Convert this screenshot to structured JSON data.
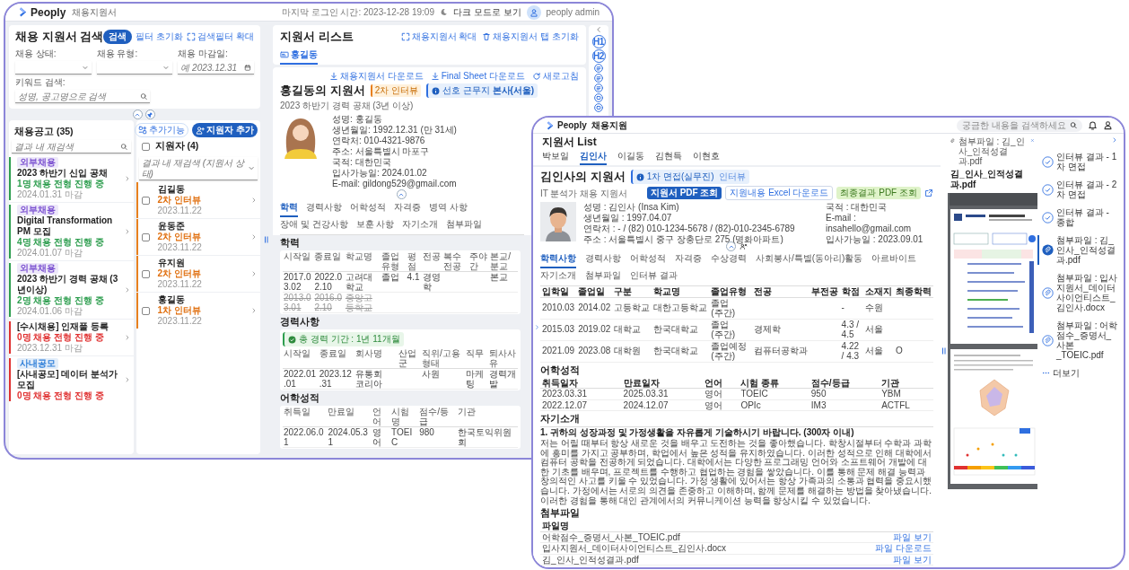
{
  "back_window": {
    "top_bar": {
      "app_name": "Peoply",
      "section": "채용지원서",
      "last_login": "마지막 로그인 시간: 2023-12-28 19:09",
      "dark_mode": "다크 모드로 보기",
      "user": "peoply admin"
    },
    "search": {
      "title": "채용 지원서 검색",
      "search_button": "검색",
      "reset_button": "필터 초기화",
      "expand_button": "검색필터 확대",
      "filters": [
        {
          "label": "채용 상태:",
          "kind": "select"
        },
        {
          "label": "채용 유형:",
          "kind": "select"
        },
        {
          "label": "채용 마감일:",
          "kind": "date",
          "placeholder": "예 2023.12.31"
        }
      ],
      "keyword": {
        "label": "키워드 검색:",
        "placeholder": "성명, 공고명으로 검색"
      }
    },
    "postings": {
      "title": "채용공고 (35)",
      "search_placeholder": "결과 내 재검색",
      "items": [
        {
          "tag": {
            "text": "외부채용",
            "color": "#7a4fd0"
          },
          "title": "2023 하반기 신입 공채",
          "status": "1명 채용 전형 진행 중",
          "deadline": "2024.01.31 마감",
          "color": "#2e9e4f"
        },
        {
          "tag": {
            "text": "외부채용",
            "color": "#7a4fd0"
          },
          "title": "Digital Transformation PM 모집",
          "status": "4명 채용 전형 진행 중",
          "deadline": "2024.01.07 마감",
          "color": "#2e9e4f"
        },
        {
          "tag": {
            "text": "외부채용",
            "color": "#7a4fd0"
          },
          "title": "2023 하반기 경력 공채 (3년이상)",
          "status": "2명 채용 전형 진행 중",
          "deadline": "2024.01.06 마감",
          "color": "#2e9e4f"
        },
        {
          "title": "[수시채용] 인재풀 등록",
          "status": "0명 채용 전형 진행 중",
          "deadline": "2023.12.31 마감",
          "color": "#e03131"
        },
        {
          "tag": {
            "text": "사내공모",
            "color": "#2f7fd8"
          },
          "title": "[사내공모] 데이터 분석가 모집",
          "status": "0명 채용 전형 진행 중",
          "color": "#e03131"
        }
      ]
    },
    "applicants": {
      "title": "지원자 (4)",
      "all_checked": false,
      "more_button": "추가기능",
      "add_button": "지원자 추가",
      "filter_placeholder": "결과 내 재검색 (지원서 상태)",
      "items": [
        {
          "name": "김길동",
          "stage": "2차 인터뷰",
          "date": "2023.11.22",
          "checked": false
        },
        {
          "name": "윤동준",
          "stage": "2차 인터뷰",
          "date": "2023.11.22",
          "checked": false
        },
        {
          "name": "유지원",
          "stage": "2차 인터뷰",
          "date": "2023.11.22",
          "checked": false
        },
        {
          "name": "홍길동",
          "stage": "1차 인터뷰",
          "date": "2023.11.22",
          "checked": false
        }
      ]
    },
    "viewer": {
      "title": "지원서 리스트",
      "expand_button": "채용지원서 확대",
      "reset_button": "채용지원서 탭 초기화",
      "tabs": [
        {
          "label": "홍길동",
          "selected": true
        }
      ],
      "actions": [
        {
          "kind": "download",
          "label": "채용지원서 다운로드"
        },
        {
          "kind": "download",
          "label": "Final Sheet 다운로드"
        },
        {
          "kind": "refresh",
          "label": "새로고침"
        }
      ],
      "heading": "홍길동의 지원서",
      "stage": "2차 인터뷰",
      "preference": "선호 근무지 **본사(서울)**",
      "subtitle": "2023 하반기 경력 공채 (3년 이상)",
      "info_left": [
        "성명: 홍길동",
        "생년월일: 1992.12.31 (만 31세)",
        "연락처: 010-4321-9876",
        "주소: 서울특별시 마포구"
      ],
      "info_right": [
        "국적: 대한민국",
        "입사가능일: 2024.01.02",
        "E-mail: gildong529@gmail.com"
      ],
      "section_tabs": [
        {
          "label": "학력",
          "selected": true
        },
        {
          "label": "경력사항",
          "selected": false
        },
        {
          "label": "어학성적",
          "selected": false
        },
        {
          "label": "자격증",
          "selected": false
        },
        {
          "label": "병역 사항",
          "selected": false
        },
        {
          "label": "장애 및 건강사항",
          "selected": false
        },
        {
          "label": "보훈 사항",
          "selected": false
        },
        {
          "label": "자기소개",
          "selected": false
        },
        {
          "label": "첨부파일",
          "selected": false
        }
      ],
      "sections": [
        {
          "title": "학력",
          "columns": [
            "시작일",
            "종료일",
            "학교명",
            "졸업유형",
            "평점",
            "전공",
            "복수전공",
            "주야간",
            "본교/분교"
          ],
          "rows": [
            {
              "cells": [
                "2017.03.02",
                "2022.02.10",
                "고려대학교",
                "졸업",
                "4.1",
                "경영학",
                null,
                null,
                "본교"
              ],
              "struck": false
            },
            {
              "cells": [
                "2013.03.01",
                "2016.02.10",
                "중앙고등학교",
                null,
                null,
                null,
                null,
                null,
                null
              ],
              "struck": true
            }
          ]
        },
        {
          "title": "경력사항",
          "summary": "총 경력 기간 : 1년 11개월",
          "columns": [
            "시작일",
            "종료일",
            "회사명",
            "산업군",
            "직위/고용형태",
            "직무",
            "퇴사사유"
          ],
          "rows": [
            {
              "cells": [
                "2022.01.01",
                "2023.12.31",
                "유통회 코리아",
                null,
                "사원",
                "마케팅",
                "경력개발"
              ],
              "struck": false
            }
          ]
        },
        {
          "title": "어학성적",
          "columns": [
            "취득일",
            "만료일",
            "언어",
            "시험명",
            "점수/등급",
            "기관"
          ],
          "rows": [
            {
              "cells": [
                "2022.06.01",
                "2024.05.31",
                "영어",
                "TOEIC",
                "980",
                "한국토익위원회"
              ],
              "struck": false
            }
          ]
        }
      ]
    },
    "rail": [
      {
        "kind": "collapse"
      },
      {
        "kind": "heading",
        "label": "H1"
      },
      {
        "kind": "heading",
        "label": "H2"
      },
      {
        "kind": "list"
      },
      {
        "kind": "list"
      },
      {
        "kind": "list"
      },
      {
        "kind": "card"
      },
      {
        "kind": "card"
      }
    ]
  },
  "front_window": {
    "top_bar": {
      "app_name": "Peoply",
      "section": "채용지원",
      "search_placeholder": "궁금한 내용을 검색하세요"
    },
    "title": "지원서 List",
    "tabs": [
      {
        "label": "박보일",
        "selected": false
      },
      {
        "label": "김인사",
        "selected": true
      },
      {
        "label": "이길동",
        "selected": false
      },
      {
        "label": "김현득",
        "selected": false
      },
      {
        "label": "이현호",
        "selected": false
      }
    ],
    "heading": "김인사의 지원서",
    "stage": "1차 면접(실무진)",
    "stage_type": "인터뷰",
    "subtitle": "IT 분석가 채용 지원서",
    "buttons": [
      {
        "label": "지원서 PDF 조회",
        "kind": "primary"
      },
      {
        "label": "지원내용 Excel 다운로드",
        "kind": "outline"
      },
      {
        "label": "최종결과 PDF 조회",
        "kind": "success"
      }
    ],
    "info_left": [
      "성명 : 김인사 (Insa Kim)",
      "생년월일 : 1997.04.07",
      "연락처 : - / (82) 010-1234-5678 / (82)-010-2345-6789",
      "주소 : 서울특별시 중구 장충단로 275 (명화아파트)"
    ],
    "info_right": [
      "국적 : 대한민국",
      "E-mail : insahello@gmail.com",
      "입사가능일 : 2023.09.01"
    ],
    "section_tabs": [
      {
        "label": "학력사항",
        "selected": true
      },
      {
        "label": "경력사항",
        "selected": false
      },
      {
        "label": "어학성적",
        "selected": false
      },
      {
        "label": "자격증",
        "selected": false
      },
      {
        "label": "수상경력",
        "selected": false
      },
      {
        "label": "사회봉사/특별(동아리)활동",
        "selected": false
      },
      {
        "label": "아르바이트",
        "selected": false
      },
      {
        "label": "자기소개",
        "selected": false
      },
      {
        "label": "첨부파일",
        "selected": false
      },
      {
        "label": "인터뷰 결과",
        "selected": false
      }
    ],
    "education": {
      "columns": [
        "입학일",
        "졸업일",
        "구분",
        "학교명",
        "졸업유형",
        "전공",
        "부전공",
        "학점",
        "소재지",
        "최종학력"
      ],
      "rows": [
        [
          "2010.03",
          "2014.02",
          "고등학교",
          "대한고등학교",
          "졸업 (주간)",
          null,
          null,
          "-",
          "수원",
          null
        ],
        [
          "2015.03",
          "2019.02",
          "대학교",
          "한국대학교",
          "졸업 (주간)",
          "경제학",
          null,
          "4.3 / 4.5",
          "서울",
          null
        ],
        [
          "2021.09",
          "2023.08",
          "대학원",
          "한국대학교",
          "졸업예정 (주간)",
          "컴퓨터공학과",
          null,
          "4.22 / 4.3",
          "서울",
          "O"
        ]
      ]
    },
    "language": {
      "title": "어학성적",
      "columns": [
        "취득일자",
        "만료일자",
        "언어",
        "시험 종류",
        "점수/등급",
        "기관"
      ],
      "rows": [
        [
          "2023.03.31",
          "2025.03.31",
          "영어",
          "TOEIC",
          "950",
          "YBM"
        ],
        [
          "2022.12.07",
          "2024.12.07",
          "영어",
          "OPIc",
          "IM3",
          "ACTFL"
        ]
      ]
    },
    "intro": {
      "title": "자기소개",
      "question": "1. 귀하의 성장과정 및 가정생활을 자유롭게 기술하시기 바랍니다. (300자 이내)",
      "answer": "저는 어릴 때부터 항상 새로운 것을 배우고 도전하는 것을 좋아했습니다. 학창시절부터 수학과 과학에 흥미를 가지고 공부하며, 학업에서 높은 성적을 유지하였습니다. 이러한 성적으로 인해 대학에서 컴퓨터 공학을 전공하게 되었습니다. 대학에서는 다양한 프로그래밍 언어와 소프트웨어 개발에 대한 기초를 배우며, 프로젝트를 수행하고 협업하는 경험을 쌓았습니다. 이를 통해 문제 해결 능력과 창의적인 사고를 키울 수 있었습니다. 가정 생활에 있어서는 항상 가족과의 소통과 협력을 중요시했습니다. 가정에서는 서로의 의견을 존중하고 이해하며, 함께 문제를 해결하는 방법을 찾아냈습니다. 이러한 경험을 통해 대인 관계에서의 커뮤니케이션 능력을 향상시킬 수 있었습니다."
    },
    "attachments": {
      "title": "첨부파일",
      "column": "파일명",
      "files": [
        {
          "name": "어학점수_증명서_사본_TOEIC.pdf",
          "action": "파일 보기"
        },
        {
          "name": "입사지원서_데이터사이언티스트_김인사.docx",
          "action": "파일 다운로드"
        },
        {
          "name": "김_인사_인적성결과.pdf",
          "action": "파일 보기"
        }
      ]
    },
    "preview": {
      "heading": "첨부파일 : 김_인사_인적성결과.pdf",
      "file_name": "김_인사_인적성결과.pdf"
    },
    "side_list": [
      {
        "kind": "check",
        "label": "인터뷰 결과 - 1차 면접",
        "selected": false
      },
      {
        "kind": "check",
        "label": "인터뷰 결과 - 2차 면접",
        "selected": false
      },
      {
        "kind": "check",
        "label": "인터뷰 결과 - 종합",
        "selected": false
      },
      {
        "kind": "attachment",
        "label": "첨부파일 : 김_인사_인적성결과.pdf",
        "selected": true
      },
      {
        "kind": "attachment",
        "label": "첨부파일 : 입사지원서_데이터사이언티스트_김인사.docx",
        "selected": false
      },
      {
        "kind": "attachment",
        "label": "첨부파일 : 어학점수_증명서_사본_TOEIC.pdf",
        "selected": false
      },
      {
        "kind": "more",
        "label": "더보기",
        "selected": false
      }
    ]
  }
}
